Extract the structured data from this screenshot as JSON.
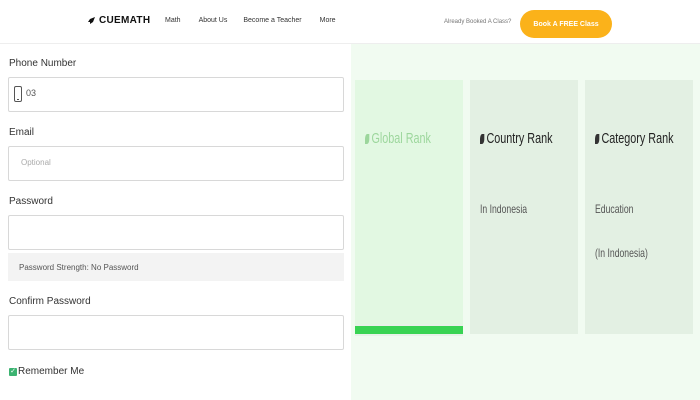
{
  "header": {
    "logo": "CUEMATH",
    "nav": [
      "Math",
      "About Us",
      "Become a Teacher",
      "More"
    ],
    "booked_text": "Already Booked A Class?",
    "book_button": "Book A FREE Class"
  },
  "form": {
    "phone_label": "Phone Number",
    "phone_value": "03",
    "email_label": "Email",
    "email_placeholder": "Optional",
    "password_label": "Password",
    "password_strength": "Password Strength: No Password",
    "confirm_label": "Confirm Password",
    "remember_label": "Remember Me",
    "remember_checked": true
  },
  "rank_cards": [
    {
      "title": "Global Rank",
      "sub": [],
      "progress_fraction": 1.0
    },
    {
      "title": "Country Rank",
      "sub": [
        "In Indonesia"
      ]
    },
    {
      "title": "Category Rank",
      "sub": [
        "Education",
        "(In Indonesia)"
      ]
    }
  ],
  "colors": {
    "accent_orange": "#fbb21a",
    "check_green": "#3cb371",
    "progress_green": "#39d353",
    "panel_bg": "#f1fbf1"
  }
}
